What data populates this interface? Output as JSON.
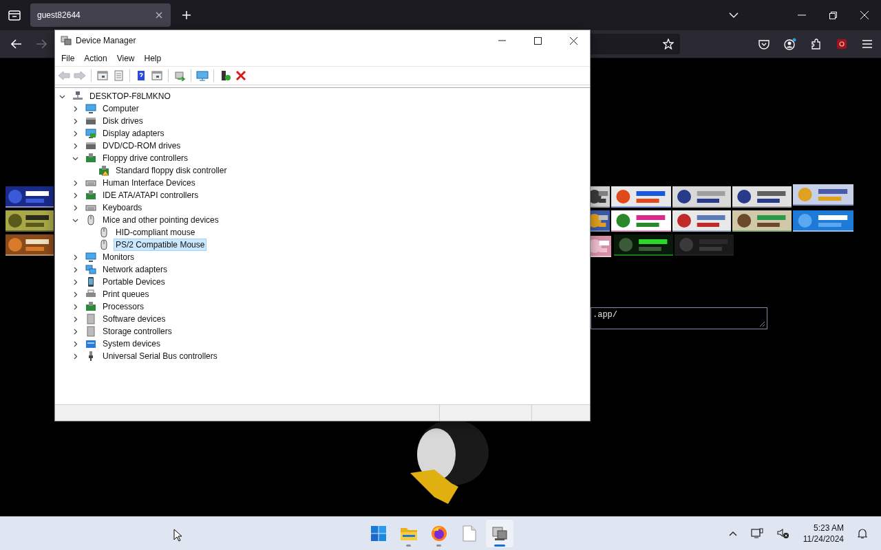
{
  "browser": {
    "tabs": [
      {
        "label": "guest82644",
        "selected": true
      }
    ],
    "nav": [
      {
        "disabled": false
      },
      {
        "disabled": true
      }
    ]
  },
  "page": {
    "url_box": {
      "value": ".app/"
    }
  },
  "device_manager": {
    "window": {
      "title": "Device Manager"
    },
    "menu": [
      "File",
      "Action",
      "View",
      "Help"
    ],
    "toolbar": [
      {
        "disabled": true
      },
      {
        "disabled": true
      },
      {
        "disabled": false
      },
      {
        "disabled": false
      },
      {
        "disabled": false
      },
      {
        "disabled": false
      },
      {
        "disabled": false
      },
      {
        "disabled": false
      },
      {
        "disabled": false
      },
      {
        "disabled": false
      }
    ],
    "tree": {
      "label": "DESKTOP-F8LMKNO",
      "expanded": true,
      "selected": false,
      "children": [
        {
          "label": "Computer",
          "expanded": false,
          "selected": false
        },
        {
          "label": "Disk drives",
          "expanded": false,
          "selected": false
        },
        {
          "label": "Display adapters",
          "expanded": false,
          "selected": false
        },
        {
          "label": "DVD/CD-ROM drives",
          "expanded": false,
          "selected": false
        },
        {
          "label": "Floppy drive controllers",
          "expanded": true,
          "selected": false,
          "children": [
            {
              "label": "Standard floppy disk controller",
              "selected": false,
              "warning": true
            }
          ]
        },
        {
          "label": "Human Interface Devices",
          "expanded": false,
          "selected": false
        },
        {
          "label": "IDE ATA/ATAPI controllers",
          "expanded": false,
          "selected": false
        },
        {
          "label": "Keyboards",
          "expanded": false,
          "selected": false
        },
        {
          "label": "Mice and other pointing devices",
          "expanded": true,
          "selected": false,
          "children": [
            {
              "label": "HID-compliant mouse",
              "selected": false,
              "warning": false
            },
            {
              "label": "PS/2 Compatible Mouse",
              "selected": true,
              "warning": false
            }
          ]
        },
        {
          "label": "Monitors",
          "expanded": false,
          "selected": false
        },
        {
          "label": "Network adapters",
          "expanded": false,
          "selected": false
        },
        {
          "label": "Portable Devices",
          "expanded": false,
          "selected": false
        },
        {
          "label": "Print queues",
          "expanded": false,
          "selected": false
        },
        {
          "label": "Processors",
          "expanded": false,
          "selected": false
        },
        {
          "label": "Software devices",
          "expanded": false,
          "selected": false
        },
        {
          "label": "Storage controllers",
          "expanded": false,
          "selected": false
        },
        {
          "label": "System devices",
          "expanded": false,
          "selected": false
        },
        {
          "label": "Universal Serial Bus controllers",
          "expanded": false,
          "selected": false
        }
      ]
    }
  },
  "taskbar": {
    "apps": [
      {
        "open": false,
        "selected": false
      },
      {
        "open": true,
        "selected": false
      },
      {
        "open": true,
        "selected": false
      },
      {
        "open": false,
        "selected": false
      },
      {
        "open": true,
        "selected": true
      }
    ],
    "clock": {
      "time": "5:23 AM",
      "date": "11/24/2024"
    }
  }
}
